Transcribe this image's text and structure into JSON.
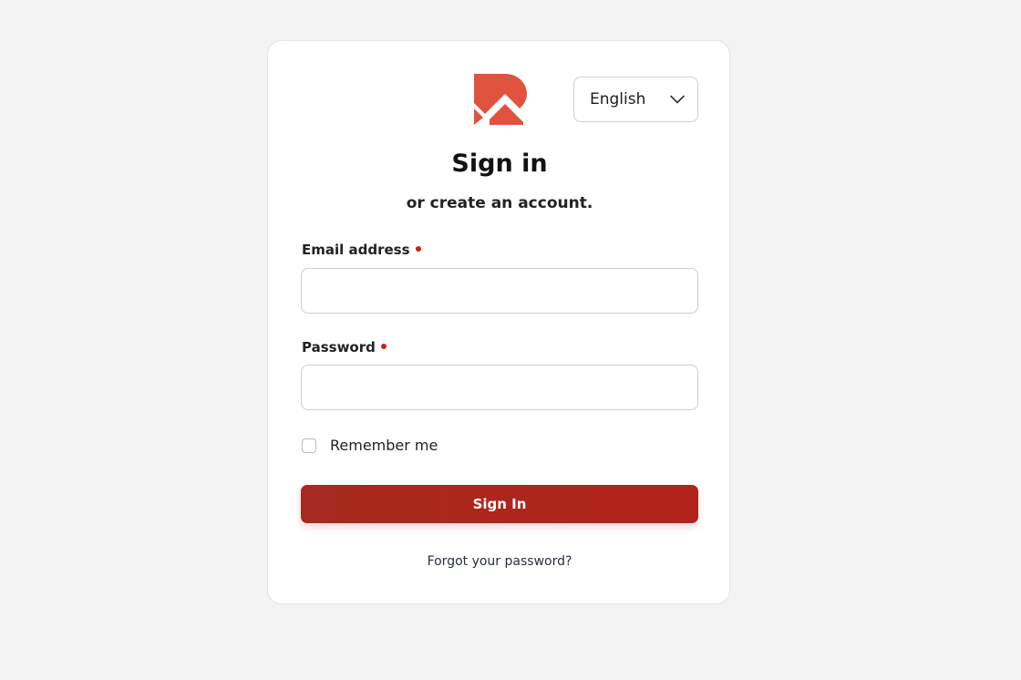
{
  "brand": {
    "logo_icon": "brand-logo-icon",
    "accent_color": "#c8412f"
  },
  "language": {
    "selected": "English",
    "icon": "chevron-down-icon"
  },
  "header": {
    "title": "Sign in",
    "subtitle": "or create an account."
  },
  "form": {
    "email_label": "Email address",
    "email_value": "",
    "password_label": "Password",
    "password_value": "",
    "required_color": "#c8211b",
    "remember_label": "Remember me",
    "remember_checked": false,
    "submit_label": "Sign In",
    "submit_color": "#a8281e",
    "forgot_label": "Forgot your password?"
  }
}
